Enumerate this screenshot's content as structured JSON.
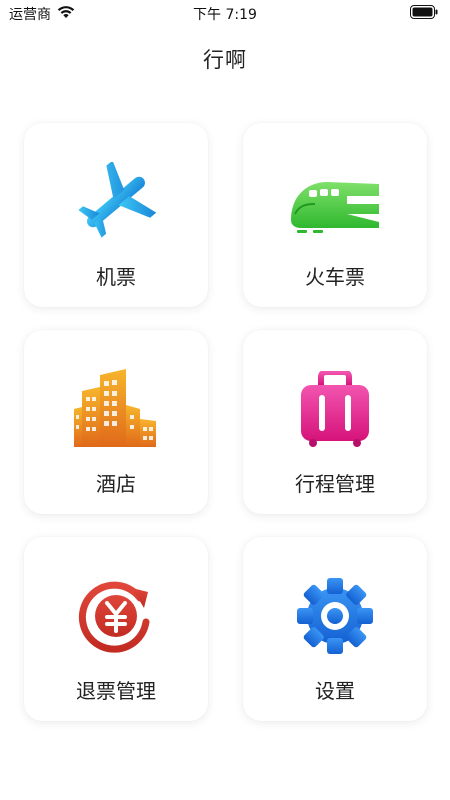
{
  "status_bar": {
    "carrier": "运营商",
    "time": "下午 7:19"
  },
  "nav": {
    "title": "行啊"
  },
  "menu": {
    "items": [
      {
        "label": "机票",
        "icon": "airplane-icon"
      },
      {
        "label": "火车票",
        "icon": "train-icon"
      },
      {
        "label": "酒店",
        "icon": "hotel-building-icon"
      },
      {
        "label": "行程管理",
        "icon": "luggage-icon"
      },
      {
        "label": "退票管理",
        "icon": "yuan-refund-icon"
      },
      {
        "label": "设置",
        "icon": "gear-icon"
      }
    ]
  },
  "colors": {
    "airplane": "#1fa3e6",
    "train": "#3cc43c",
    "hotel": "#f0941c",
    "luggage": "#e8238f",
    "refund": "#d23a2c",
    "settings": "#1e78e8"
  }
}
